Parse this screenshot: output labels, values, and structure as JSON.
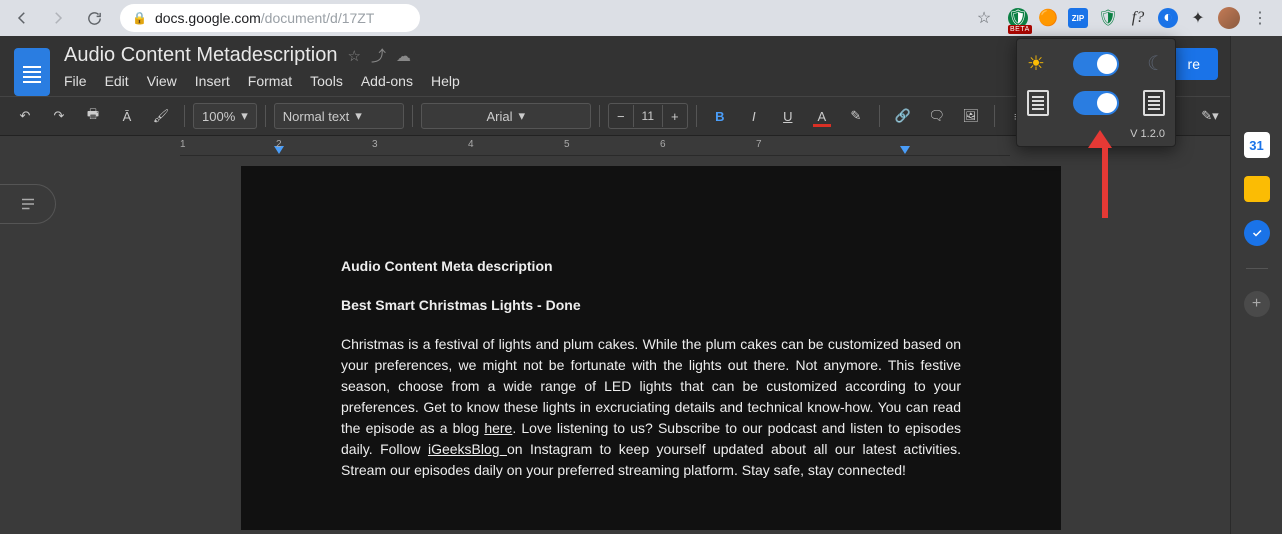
{
  "browser": {
    "url_host": "docs.google.com",
    "url_path": "/document/d/17ZT",
    "extensions": [
      "shield-beta",
      "alize",
      "zip",
      "adblock",
      "whatfont",
      "dark-reader",
      "extensions",
      "profile"
    ]
  },
  "docs": {
    "title": "Audio Content Metadescription",
    "menus": [
      "File",
      "Edit",
      "View",
      "Insert",
      "Format",
      "Tools",
      "Add-ons",
      "Help"
    ],
    "share_label": "re",
    "toolbar": {
      "zoom": "100%",
      "style": "Normal text",
      "font": "Arial",
      "font_size": "11"
    },
    "ruler_numbers": [
      "1",
      "2",
      "3",
      "4",
      "5",
      "6",
      "7"
    ]
  },
  "document": {
    "heading": "Audio Content Meta description",
    "subheading": "Best Smart Christmas Lights - Done",
    "body_pre": "Christmas is a festival of lights and plum cakes. While the plum cakes can be customized based on your preferences, we might not be fortunate with the lights out there. Not anymore. This festive season, choose from a wide range of LED lights that can be customized according to your preferences. Get to know these lights in excruciating details and technical know-how. You can read the episode as a blog ",
    "link1": "here",
    "body_mid": ". Love listening to us? Subscribe to our podcast and listen to episodes daily. Follow ",
    "link2": "iGeeksBlog ",
    "body_post": "on Instagram to keep yourself updated about all our latest activities. Stream our episodes daily on your preferred streaming platform. Stay safe, stay connected!"
  },
  "side_rail": {
    "calendar": "31"
  },
  "extension_popup": {
    "version": "V 1.2.0"
  }
}
